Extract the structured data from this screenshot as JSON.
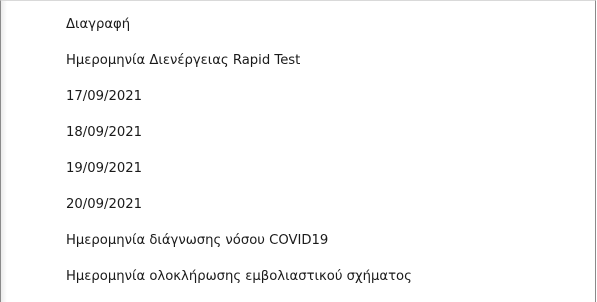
{
  "dropdown": {
    "items": [
      {
        "label": "Διαγραφή"
      },
      {
        "label": "Ημερομηνία Διενέργειας Rapid Test"
      },
      {
        "label": "17/09/2021"
      },
      {
        "label": "18/09/2021"
      },
      {
        "label": "19/09/2021"
      },
      {
        "label": "20/09/2021"
      },
      {
        "label": "Ημερομηνία διάγνωσης νόσου COVID19"
      },
      {
        "label": "Ημερομηνία ολοκλήρωσης εμβολιαστικού σχήματος"
      }
    ]
  }
}
